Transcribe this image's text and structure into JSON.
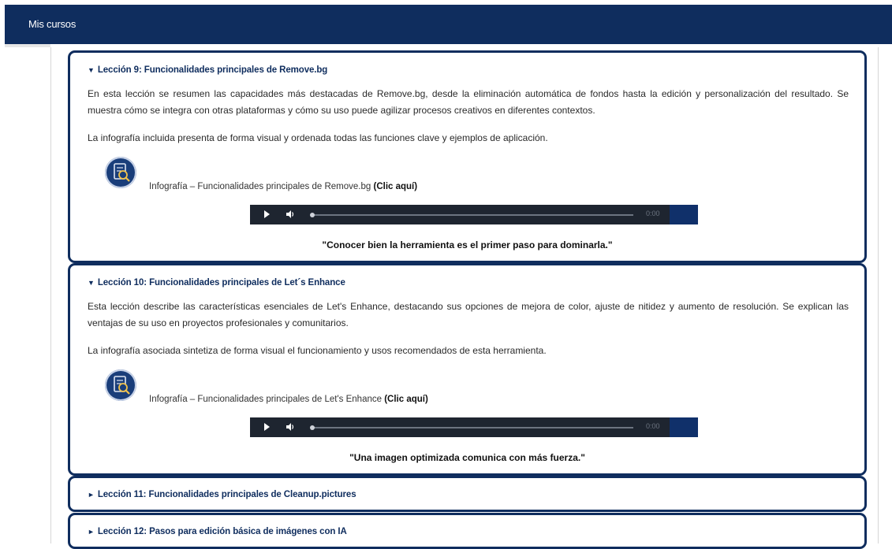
{
  "nav": {
    "my_courses": "Mis cursos"
  },
  "lessons": [
    {
      "title": "Lección 9: Funcionalidades principales de Remove.bg",
      "expanded": true,
      "paragraph1": "En esta lección se resumen las capacidades más destacadas de Remove.bg, desde la eliminación automática de fondos hasta la edición y personalización del resultado. Se muestra cómo se integra con otras plataformas y cómo su uso puede agilizar procesos creativos en diferentes contextos.",
      "paragraph2": "La infografía incluida presenta de forma visual y ordenada todas las funciones clave y ejemplos de aplicación.",
      "infographic_text": "Infografía – Funcionalidades principales de Remove.bg ",
      "infographic_link": "(Clic aquí)",
      "audio_time": "0:00",
      "quote": "\"Conocer bien la herramienta es el primer paso para dominarla.\""
    },
    {
      "title": "Lección 10: Funcionalidades principales de Let´s Enhance",
      "expanded": true,
      "paragraph1": "Esta lección describe las características esenciales de Let's Enhance, destacando sus opciones de mejora de color, ajuste de nitidez y aumento de resolución. Se explican las ventajas de su uso en proyectos profesionales y comunitarios.",
      "paragraph2": "La infografía asociada sintetiza de forma visual el funcionamiento y usos recomendados de esta herramienta.",
      "infographic_text": "Infografía – Funcionalidades principales de Let's Enhance ",
      "infographic_link": "(Clic aquí)",
      "audio_time": "0:00",
      "quote": "\"Una imagen optimizada comunica con más fuerza.\""
    },
    {
      "title": "Lección 11: Funcionalidades principales de Cleanup.pictures",
      "expanded": false
    },
    {
      "title": "Lección 12: Pasos para edición básica de imágenes con IA",
      "expanded": false
    }
  ],
  "icons": {
    "collapse_arrow": "▼",
    "expand_arrow": "►",
    "infographic": "document-magnifier-icon",
    "play": "play-icon",
    "volume": "volume-icon"
  },
  "colors": {
    "brand_navy": "#0f2d5e",
    "audio_bar": "#1e2530"
  }
}
